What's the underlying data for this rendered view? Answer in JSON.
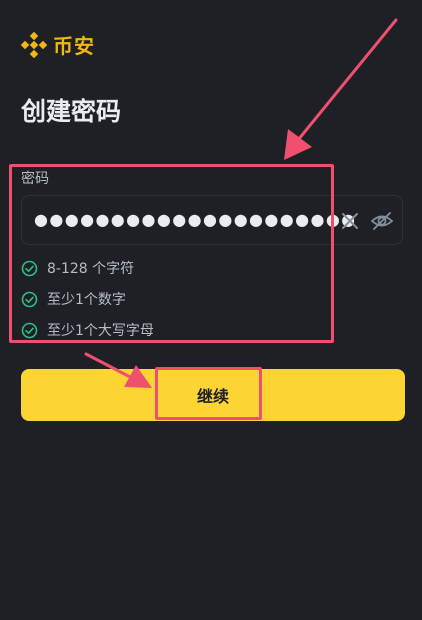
{
  "brand": {
    "name": "币安",
    "accent_color": "#f0b90b",
    "logo_icon": "binance-diamond-icon"
  },
  "page": {
    "title": "创建密码"
  },
  "password_field": {
    "label": "密码",
    "masked_value": "●●●●●●●●●●●●●●●●●●●●●●●●●●●●●●",
    "clear_icon": "close-icon",
    "visibility_icon": "eye-off-icon"
  },
  "requirements": [
    {
      "text": "8-128 个字符",
      "met": true
    },
    {
      "text": "至少1个数字",
      "met": true
    },
    {
      "text": "至少1个大写字母",
      "met": true
    }
  ],
  "continue_button": {
    "label": "继续",
    "color": "#fcd535"
  },
  "annotation_color": "#f0506e"
}
